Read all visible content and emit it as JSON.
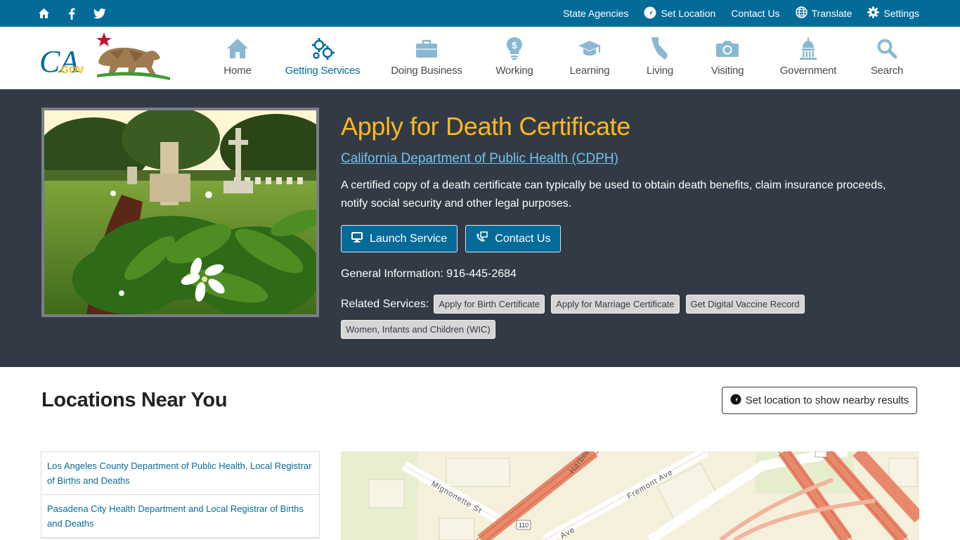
{
  "utility": {
    "left_icons": [
      "home-icon",
      "facebook-icon",
      "twitter-icon"
    ],
    "links": [
      {
        "label": "State Agencies",
        "icon": ""
      },
      {
        "label": "Set Location",
        "icon": "location-icon"
      },
      {
        "label": "Contact Us",
        "icon": ""
      },
      {
        "label": "Translate",
        "icon": "globe-icon"
      },
      {
        "label": "Settings",
        "icon": "gear-icon"
      }
    ]
  },
  "logo": {
    "text": "CA",
    "sub": ".GOV"
  },
  "nav": {
    "items": [
      {
        "label": "Home",
        "icon": "house-icon"
      },
      {
        "label": "Getting Services",
        "icon": "gears-icon",
        "active": true
      },
      {
        "label": "Doing Business",
        "icon": "briefcase-icon"
      },
      {
        "label": "Working",
        "icon": "lightbulb-dollar-icon"
      },
      {
        "label": "Learning",
        "icon": "graduation-cap-icon"
      },
      {
        "label": "Living",
        "icon": "california-icon"
      },
      {
        "label": "Visiting",
        "icon": "camera-icon"
      },
      {
        "label": "Government",
        "icon": "capitol-icon"
      },
      {
        "label": "Search",
        "icon": "search-icon"
      }
    ]
  },
  "hero": {
    "title": "Apply for Death Certificate",
    "department": "California Department of Public Health (CDPH)",
    "description": "A certified copy of a death certificate can typically be used to obtain death benefits, claim insurance proceeds, notify social security and other legal purposes.",
    "buttons": {
      "launch": "Launch Service",
      "contact": "Contact Us"
    },
    "general_info": "General Information: 916-445-2684",
    "related_label": "Related Services:",
    "related": [
      "Apply for Birth Certificate",
      "Apply for Marriage Certificate",
      "Get Digital Vaccine Record",
      "Women, Infants and Children (WIC)"
    ]
  },
  "locations": {
    "title": "Locations Near You",
    "set_location_label": "Set location to show nearby results",
    "items": [
      "Los Angeles County Department of Public Health, Local Registrar of Births and Deaths",
      "Pasadena City Health Department and Local Registrar of Births and Deaths"
    ]
  },
  "map": {
    "labels": {
      "harbor": "Harbor",
      "fremont": "Fremont Ave",
      "mignonette": "Mignonette St",
      "route": "110",
      "ave": "Ave"
    }
  },
  "colors": {
    "primary": "#046b99",
    "hero_bg": "#323a45",
    "title": "#fdb81e",
    "link": "#72c3ee",
    "nav_icon": "#8ab8d4"
  }
}
